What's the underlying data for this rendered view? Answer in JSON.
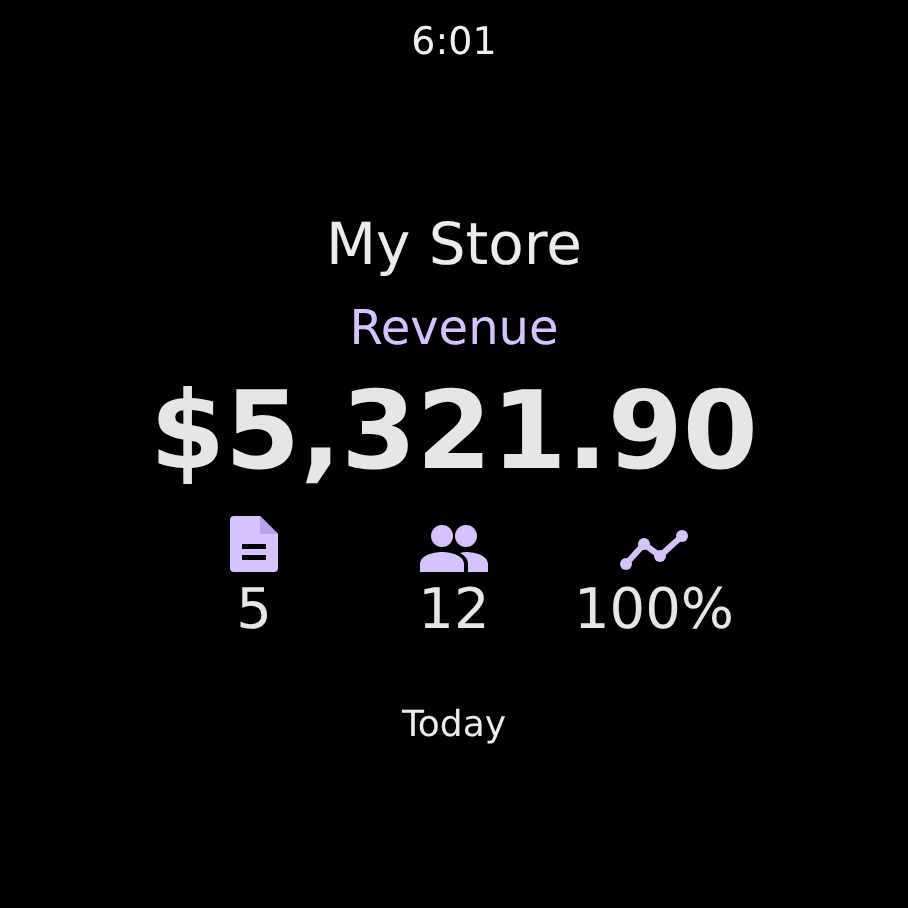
{
  "status_bar": {
    "time": "6:01"
  },
  "store_name": "My Store",
  "metric_label": "Revenue",
  "amount": "$5,321.90",
  "stats": [
    {
      "kind": "orders",
      "value": "5"
    },
    {
      "kind": "customers",
      "value": "12"
    },
    {
      "kind": "trend",
      "value": "100%"
    }
  ],
  "period": "Today"
}
